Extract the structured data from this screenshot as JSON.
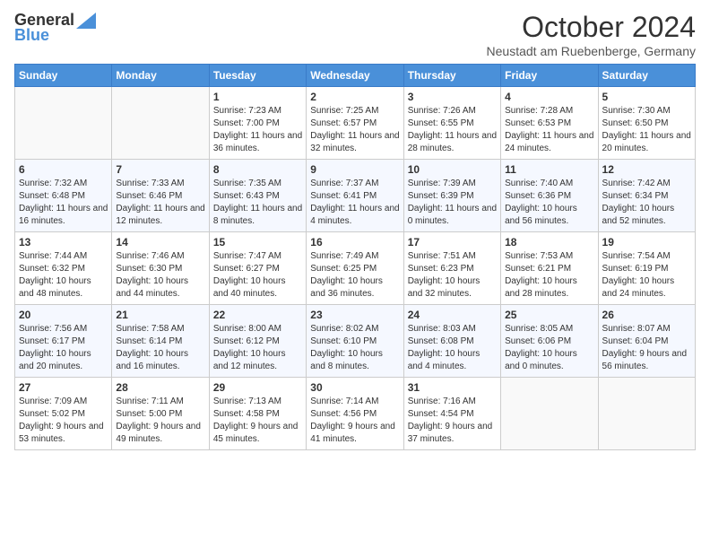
{
  "logo": {
    "general": "General",
    "blue": "Blue"
  },
  "title": "October 2024",
  "subtitle": "Neustadt am Ruebenberge, Germany",
  "days_of_week": [
    "Sunday",
    "Monday",
    "Tuesday",
    "Wednesday",
    "Thursday",
    "Friday",
    "Saturday"
  ],
  "weeks": [
    [
      {
        "day": "",
        "sunrise": "",
        "sunset": "",
        "daylight": ""
      },
      {
        "day": "",
        "sunrise": "",
        "sunset": "",
        "daylight": ""
      },
      {
        "day": "1",
        "sunrise": "Sunrise: 7:23 AM",
        "sunset": "Sunset: 7:00 PM",
        "daylight": "Daylight: 11 hours and 36 minutes."
      },
      {
        "day": "2",
        "sunrise": "Sunrise: 7:25 AM",
        "sunset": "Sunset: 6:57 PM",
        "daylight": "Daylight: 11 hours and 32 minutes."
      },
      {
        "day": "3",
        "sunrise": "Sunrise: 7:26 AM",
        "sunset": "Sunset: 6:55 PM",
        "daylight": "Daylight: 11 hours and 28 minutes."
      },
      {
        "day": "4",
        "sunrise": "Sunrise: 7:28 AM",
        "sunset": "Sunset: 6:53 PM",
        "daylight": "Daylight: 11 hours and 24 minutes."
      },
      {
        "day": "5",
        "sunrise": "Sunrise: 7:30 AM",
        "sunset": "Sunset: 6:50 PM",
        "daylight": "Daylight: 11 hours and 20 minutes."
      }
    ],
    [
      {
        "day": "6",
        "sunrise": "Sunrise: 7:32 AM",
        "sunset": "Sunset: 6:48 PM",
        "daylight": "Daylight: 11 hours and 16 minutes."
      },
      {
        "day": "7",
        "sunrise": "Sunrise: 7:33 AM",
        "sunset": "Sunset: 6:46 PM",
        "daylight": "Daylight: 11 hours and 12 minutes."
      },
      {
        "day": "8",
        "sunrise": "Sunrise: 7:35 AM",
        "sunset": "Sunset: 6:43 PM",
        "daylight": "Daylight: 11 hours and 8 minutes."
      },
      {
        "day": "9",
        "sunrise": "Sunrise: 7:37 AM",
        "sunset": "Sunset: 6:41 PM",
        "daylight": "Daylight: 11 hours and 4 minutes."
      },
      {
        "day": "10",
        "sunrise": "Sunrise: 7:39 AM",
        "sunset": "Sunset: 6:39 PM",
        "daylight": "Daylight: 11 hours and 0 minutes."
      },
      {
        "day": "11",
        "sunrise": "Sunrise: 7:40 AM",
        "sunset": "Sunset: 6:36 PM",
        "daylight": "Daylight: 10 hours and 56 minutes."
      },
      {
        "day": "12",
        "sunrise": "Sunrise: 7:42 AM",
        "sunset": "Sunset: 6:34 PM",
        "daylight": "Daylight: 10 hours and 52 minutes."
      }
    ],
    [
      {
        "day": "13",
        "sunrise": "Sunrise: 7:44 AM",
        "sunset": "Sunset: 6:32 PM",
        "daylight": "Daylight: 10 hours and 48 minutes."
      },
      {
        "day": "14",
        "sunrise": "Sunrise: 7:46 AM",
        "sunset": "Sunset: 6:30 PM",
        "daylight": "Daylight: 10 hours and 44 minutes."
      },
      {
        "day": "15",
        "sunrise": "Sunrise: 7:47 AM",
        "sunset": "Sunset: 6:27 PM",
        "daylight": "Daylight: 10 hours and 40 minutes."
      },
      {
        "day": "16",
        "sunrise": "Sunrise: 7:49 AM",
        "sunset": "Sunset: 6:25 PM",
        "daylight": "Daylight: 10 hours and 36 minutes."
      },
      {
        "day": "17",
        "sunrise": "Sunrise: 7:51 AM",
        "sunset": "Sunset: 6:23 PM",
        "daylight": "Daylight: 10 hours and 32 minutes."
      },
      {
        "day": "18",
        "sunrise": "Sunrise: 7:53 AM",
        "sunset": "Sunset: 6:21 PM",
        "daylight": "Daylight: 10 hours and 28 minutes."
      },
      {
        "day": "19",
        "sunrise": "Sunrise: 7:54 AM",
        "sunset": "Sunset: 6:19 PM",
        "daylight": "Daylight: 10 hours and 24 minutes."
      }
    ],
    [
      {
        "day": "20",
        "sunrise": "Sunrise: 7:56 AM",
        "sunset": "Sunset: 6:17 PM",
        "daylight": "Daylight: 10 hours and 20 minutes."
      },
      {
        "day": "21",
        "sunrise": "Sunrise: 7:58 AM",
        "sunset": "Sunset: 6:14 PM",
        "daylight": "Daylight: 10 hours and 16 minutes."
      },
      {
        "day": "22",
        "sunrise": "Sunrise: 8:00 AM",
        "sunset": "Sunset: 6:12 PM",
        "daylight": "Daylight: 10 hours and 12 minutes."
      },
      {
        "day": "23",
        "sunrise": "Sunrise: 8:02 AM",
        "sunset": "Sunset: 6:10 PM",
        "daylight": "Daylight: 10 hours and 8 minutes."
      },
      {
        "day": "24",
        "sunrise": "Sunrise: 8:03 AM",
        "sunset": "Sunset: 6:08 PM",
        "daylight": "Daylight: 10 hours and 4 minutes."
      },
      {
        "day": "25",
        "sunrise": "Sunrise: 8:05 AM",
        "sunset": "Sunset: 6:06 PM",
        "daylight": "Daylight: 10 hours and 0 minutes."
      },
      {
        "day": "26",
        "sunrise": "Sunrise: 8:07 AM",
        "sunset": "Sunset: 6:04 PM",
        "daylight": "Daylight: 9 hours and 56 minutes."
      }
    ],
    [
      {
        "day": "27",
        "sunrise": "Sunrise: 7:09 AM",
        "sunset": "Sunset: 5:02 PM",
        "daylight": "Daylight: 9 hours and 53 minutes."
      },
      {
        "day": "28",
        "sunrise": "Sunrise: 7:11 AM",
        "sunset": "Sunset: 5:00 PM",
        "daylight": "Daylight: 9 hours and 49 minutes."
      },
      {
        "day": "29",
        "sunrise": "Sunrise: 7:13 AM",
        "sunset": "Sunset: 4:58 PM",
        "daylight": "Daylight: 9 hours and 45 minutes."
      },
      {
        "day": "30",
        "sunrise": "Sunrise: 7:14 AM",
        "sunset": "Sunset: 4:56 PM",
        "daylight": "Daylight: 9 hours and 41 minutes."
      },
      {
        "day": "31",
        "sunrise": "Sunrise: 7:16 AM",
        "sunset": "Sunset: 4:54 PM",
        "daylight": "Daylight: 9 hours and 37 minutes."
      },
      {
        "day": "",
        "sunrise": "",
        "sunset": "",
        "daylight": ""
      },
      {
        "day": "",
        "sunrise": "",
        "sunset": "",
        "daylight": ""
      }
    ]
  ]
}
